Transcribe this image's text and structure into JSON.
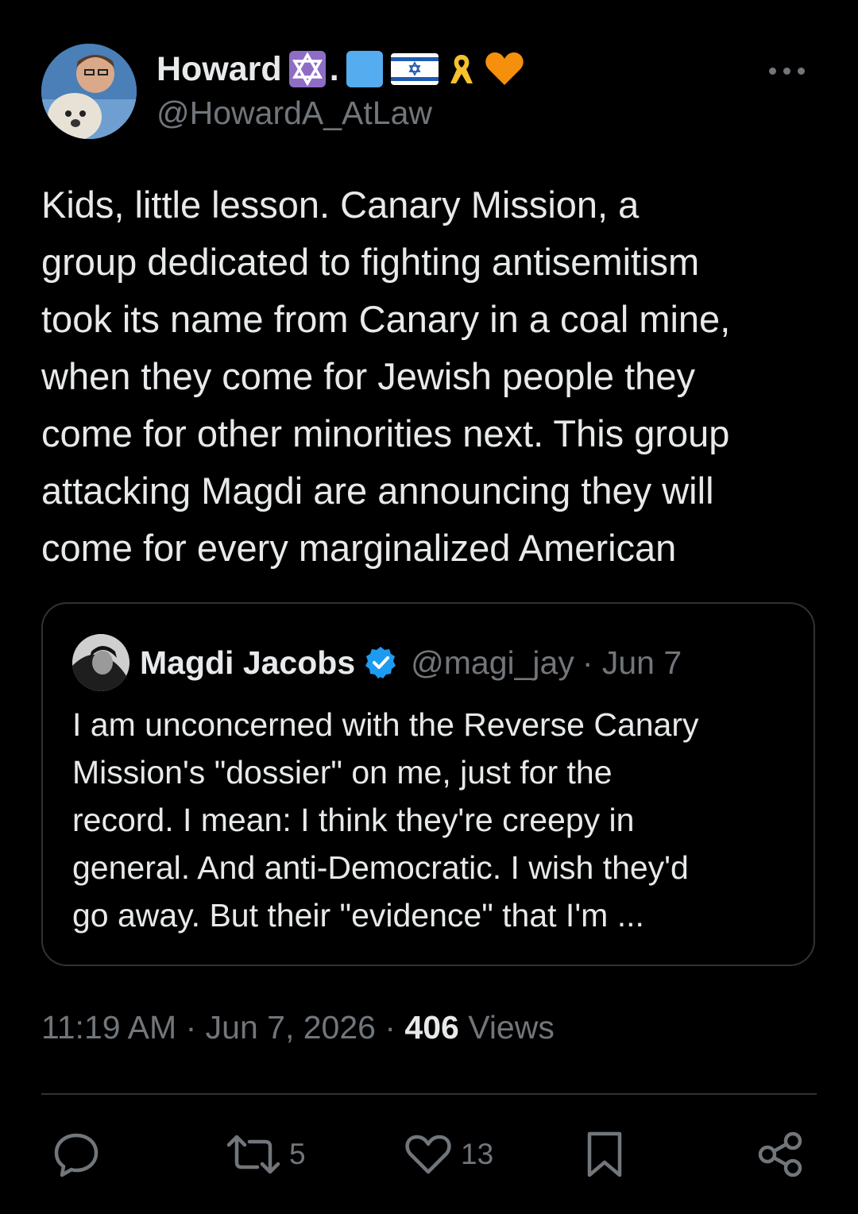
{
  "author": {
    "display_name": "Howard",
    "handle": "@HowardA_AtLaw",
    "badge_dot": ".",
    "icons": [
      "star-of-david-emoji",
      "blue-square-emoji",
      "israel-flag-emoji",
      "yellow-ribbon-emoji",
      "orange-heart-emoji"
    ]
  },
  "tweet": {
    "text": "Kids, little lesson. Canary Mission, a\ngroup dedicated to fighting antisemitism\ntook its name from Canary in a coal mine,\nwhen they come for Jewish people they\ncome for other minorities next. This group\nattacking Magdi are announcing they will\ncome for every marginalized American"
  },
  "quote": {
    "name": "Magdi Jacobs",
    "handle": "@magi_jay",
    "date": "· Jun 7",
    "text": "I am unconcerned with the Reverse Canary\nMission's \"dossier\" on me, just for the\nrecord. I mean: I think they're creepy in\ngeneral. And anti-Democratic. I wish they'd\ngo away. But their \"evidence\" that I'm ..."
  },
  "meta": {
    "time": "11:19 AM",
    "date": "Jun 7, 2026",
    "views_count": "406",
    "views_label": "Views"
  },
  "actions": {
    "reposts": "5",
    "likes": "13"
  },
  "colors": {
    "background": "#000000",
    "text": "#e7e9ea",
    "muted": "#71767b",
    "border": "#2f3336",
    "verified": "#1d9bf0"
  }
}
